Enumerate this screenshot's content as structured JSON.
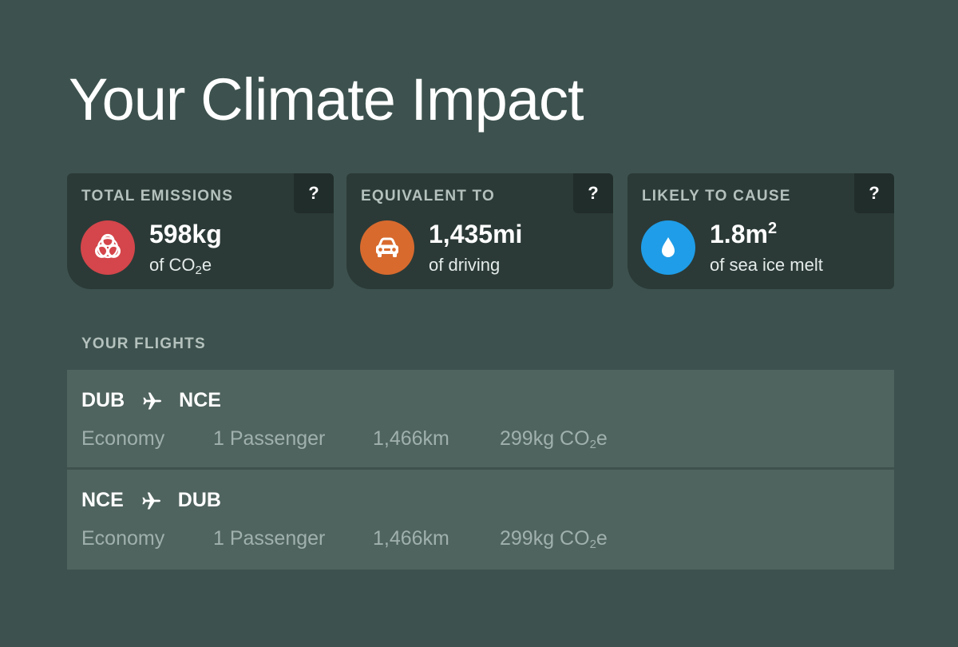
{
  "page": {
    "title": "Your Climate Impact"
  },
  "cards": [
    {
      "label": "TOTAL EMISSIONS",
      "help": "?",
      "icon": "biohazard-icon",
      "color": "#d4464b",
      "value": "598kg",
      "unit_prefix": "of CO",
      "unit_sub": "2",
      "unit_suffix": "e"
    },
    {
      "label": "EQUIVALENT TO",
      "help": "?",
      "icon": "car-icon",
      "color": "#d86a2e",
      "value": "1,435mi",
      "unit": "of driving"
    },
    {
      "label": "LIKELY TO CAUSE",
      "help": "?",
      "icon": "water-drop-icon",
      "color": "#1f9de8",
      "value_base": "1.8m",
      "value_sup": "2",
      "unit": "of sea ice melt"
    }
  ],
  "flights_section": {
    "label": "YOUR FLIGHTS"
  },
  "flights": [
    {
      "from": "DUB",
      "to": "NCE",
      "class": "Economy",
      "passengers": "1 Passenger",
      "distance": "1,466km",
      "co2_prefix": "299kg CO",
      "co2_sub": "2",
      "co2_suffix": "e"
    },
    {
      "from": "NCE",
      "to": "DUB",
      "class": "Economy",
      "passengers": "1 Passenger",
      "distance": "1,466km",
      "co2_prefix": "299kg CO",
      "co2_sub": "2",
      "co2_suffix": "e"
    }
  ]
}
